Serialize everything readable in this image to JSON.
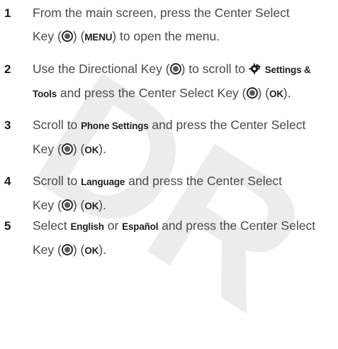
{
  "watermark": "DR",
  "steps": [
    {
      "num": "1",
      "text_a": "From the main screen, press the Center Select",
      "text_b": "Key (",
      "text_c": ") (",
      "ui_1": "MENU",
      "text_d": ") to open the menu."
    },
    {
      "num": "2",
      "text_a": "Use the Directional Key (",
      "text_b": ") to scroll to ",
      "ui_1": "Settings &",
      "ui_2": "Tools",
      "text_c": " and press the Center Select Key (",
      "text_d": ") (",
      "ui_3": "OK",
      "text_e": ")."
    },
    {
      "num": "3",
      "text_a": "Scroll to ",
      "ui_1": "Phone Settings",
      "text_b": " and press the Center Select",
      "text_c": "Key (",
      "text_d": ") (",
      "ui_2": "OK",
      "text_e": ")."
    },
    {
      "num": "4",
      "text_a": "Scroll to ",
      "ui_1": "Language",
      "text_b": " and press the Center Select",
      "text_c": "Key (",
      "text_d": ") (",
      "ui_2": "OK",
      "text_e": ")."
    },
    {
      "num": "5",
      "text_a": "Select ",
      "ui_1": "English",
      "text_b": " or ",
      "ui_2": "Español",
      "text_c": " and press the Center Select",
      "text_d": "Key (",
      "text_e": ") (",
      "ui_3": "OK",
      "text_f": ")."
    }
  ],
  "icons": {
    "center_select": "center-select-key-icon",
    "directional": "directional-key-icon",
    "settings": "settings-gear-icon"
  }
}
